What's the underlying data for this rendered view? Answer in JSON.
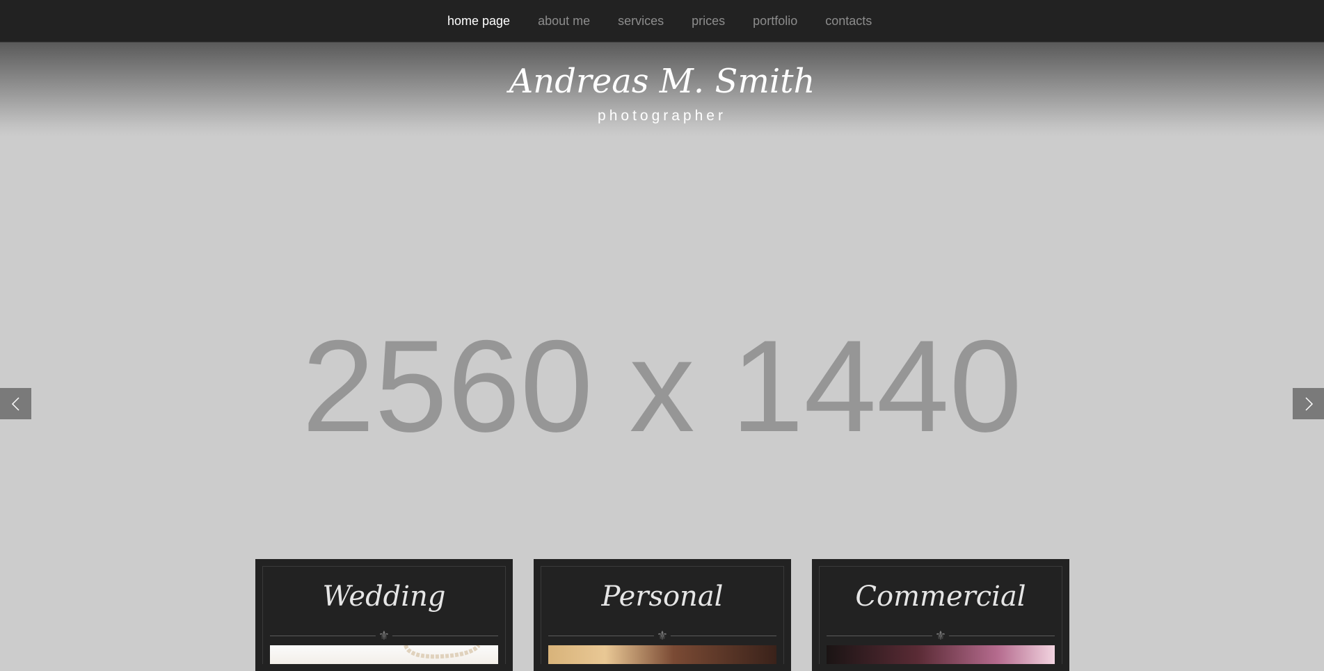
{
  "nav": {
    "items": [
      {
        "label": "home page",
        "active": true
      },
      {
        "label": "about me",
        "active": false
      },
      {
        "label": "services",
        "active": false
      },
      {
        "label": "prices",
        "active": false
      },
      {
        "label": "portfolio",
        "active": false
      },
      {
        "label": "contacts",
        "active": false
      }
    ]
  },
  "brand": {
    "name": "Andreas M. Smith",
    "role": "photographer"
  },
  "hero": {
    "placeholder": "2560 x 1440",
    "prev_icon": "chevron-left-icon",
    "next_icon": "chevron-right-icon"
  },
  "cards": [
    {
      "title": "Wedding",
      "ornament": "⚜",
      "photo": "wedding-photo"
    },
    {
      "title": "Personal",
      "ornament": "⚜",
      "photo": "personal-photo"
    },
    {
      "title": "Commercial",
      "ornament": "⚜",
      "photo": "commercial-photo"
    }
  ],
  "colors": {
    "nav_bg": "#222222",
    "hero_bg": "#cccccc",
    "card_bg": "#222222"
  }
}
